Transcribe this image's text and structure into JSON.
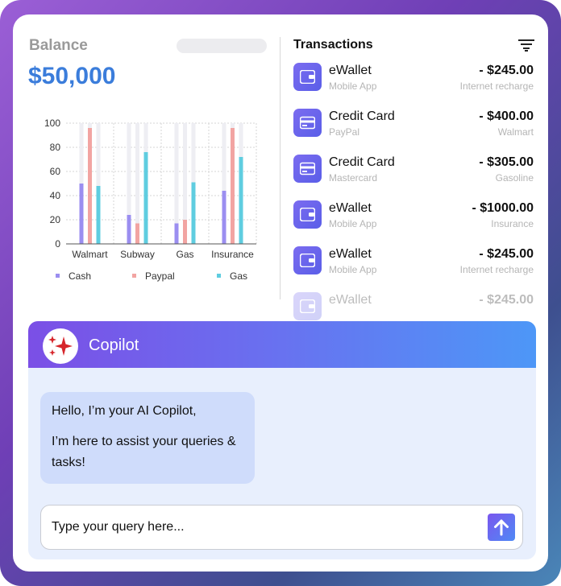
{
  "balance": {
    "label": "Balance",
    "amount": "$50,000"
  },
  "chart_data": {
    "type": "bar",
    "categories": [
      "Walmart",
      "Subway",
      "Gas",
      "Insurance"
    ],
    "series": [
      {
        "name": "Cash",
        "values": [
          50,
          24,
          17,
          44
        ],
        "color": "#9b8ef0"
      },
      {
        "name": "Paypal",
        "values": [
          96,
          17,
          20,
          96
        ],
        "color": "#f2a4a2"
      },
      {
        "name": "Gas",
        "values": [
          48,
          76,
          51,
          72
        ],
        "color": "#5fcde0"
      }
    ],
    "background_bar_color": "#eeeef3",
    "ylim": [
      0,
      100
    ],
    "yticks": [
      0,
      20,
      40,
      60,
      80,
      100
    ],
    "grid": true,
    "legend_position": "bottom"
  },
  "transactions": {
    "title": "Transactions",
    "filter_icon": "filter-icon",
    "items": [
      {
        "name": "eWallet",
        "source": "Mobile App",
        "amount": "- $245.00",
        "note": "Internet recharge",
        "icon": "wallet-icon"
      },
      {
        "name": "Credit Card",
        "source": "PayPal",
        "amount": "- $400.00",
        "note": "Walmart",
        "icon": "credit-card-icon"
      },
      {
        "name": "Credit Card",
        "source": "Mastercard",
        "amount": "- $305.00",
        "note": "Gasoline",
        "icon": "credit-card-icon"
      },
      {
        "name": "eWallet",
        "source": "Mobile App",
        "amount": "- $1000.00",
        "note": "Insurance",
        "icon": "wallet-icon"
      },
      {
        "name": "eWallet",
        "source": "Mobile App",
        "amount": "- $245.00",
        "note": "Internet recharge",
        "icon": "wallet-icon"
      },
      {
        "name": "eWallet",
        "source": "",
        "amount": "- $245.00",
        "note": "",
        "icon": "wallet-icon"
      }
    ]
  },
  "copilot": {
    "title": "Copilot",
    "logo_icon": "sparkle-icon",
    "message_line1": "Hello, I’m your AI Copilot,",
    "message_line2": "I’m here to assist your queries & tasks!",
    "input_placeholder": "Type your query here...",
    "send_icon": "arrow-up-icon"
  }
}
